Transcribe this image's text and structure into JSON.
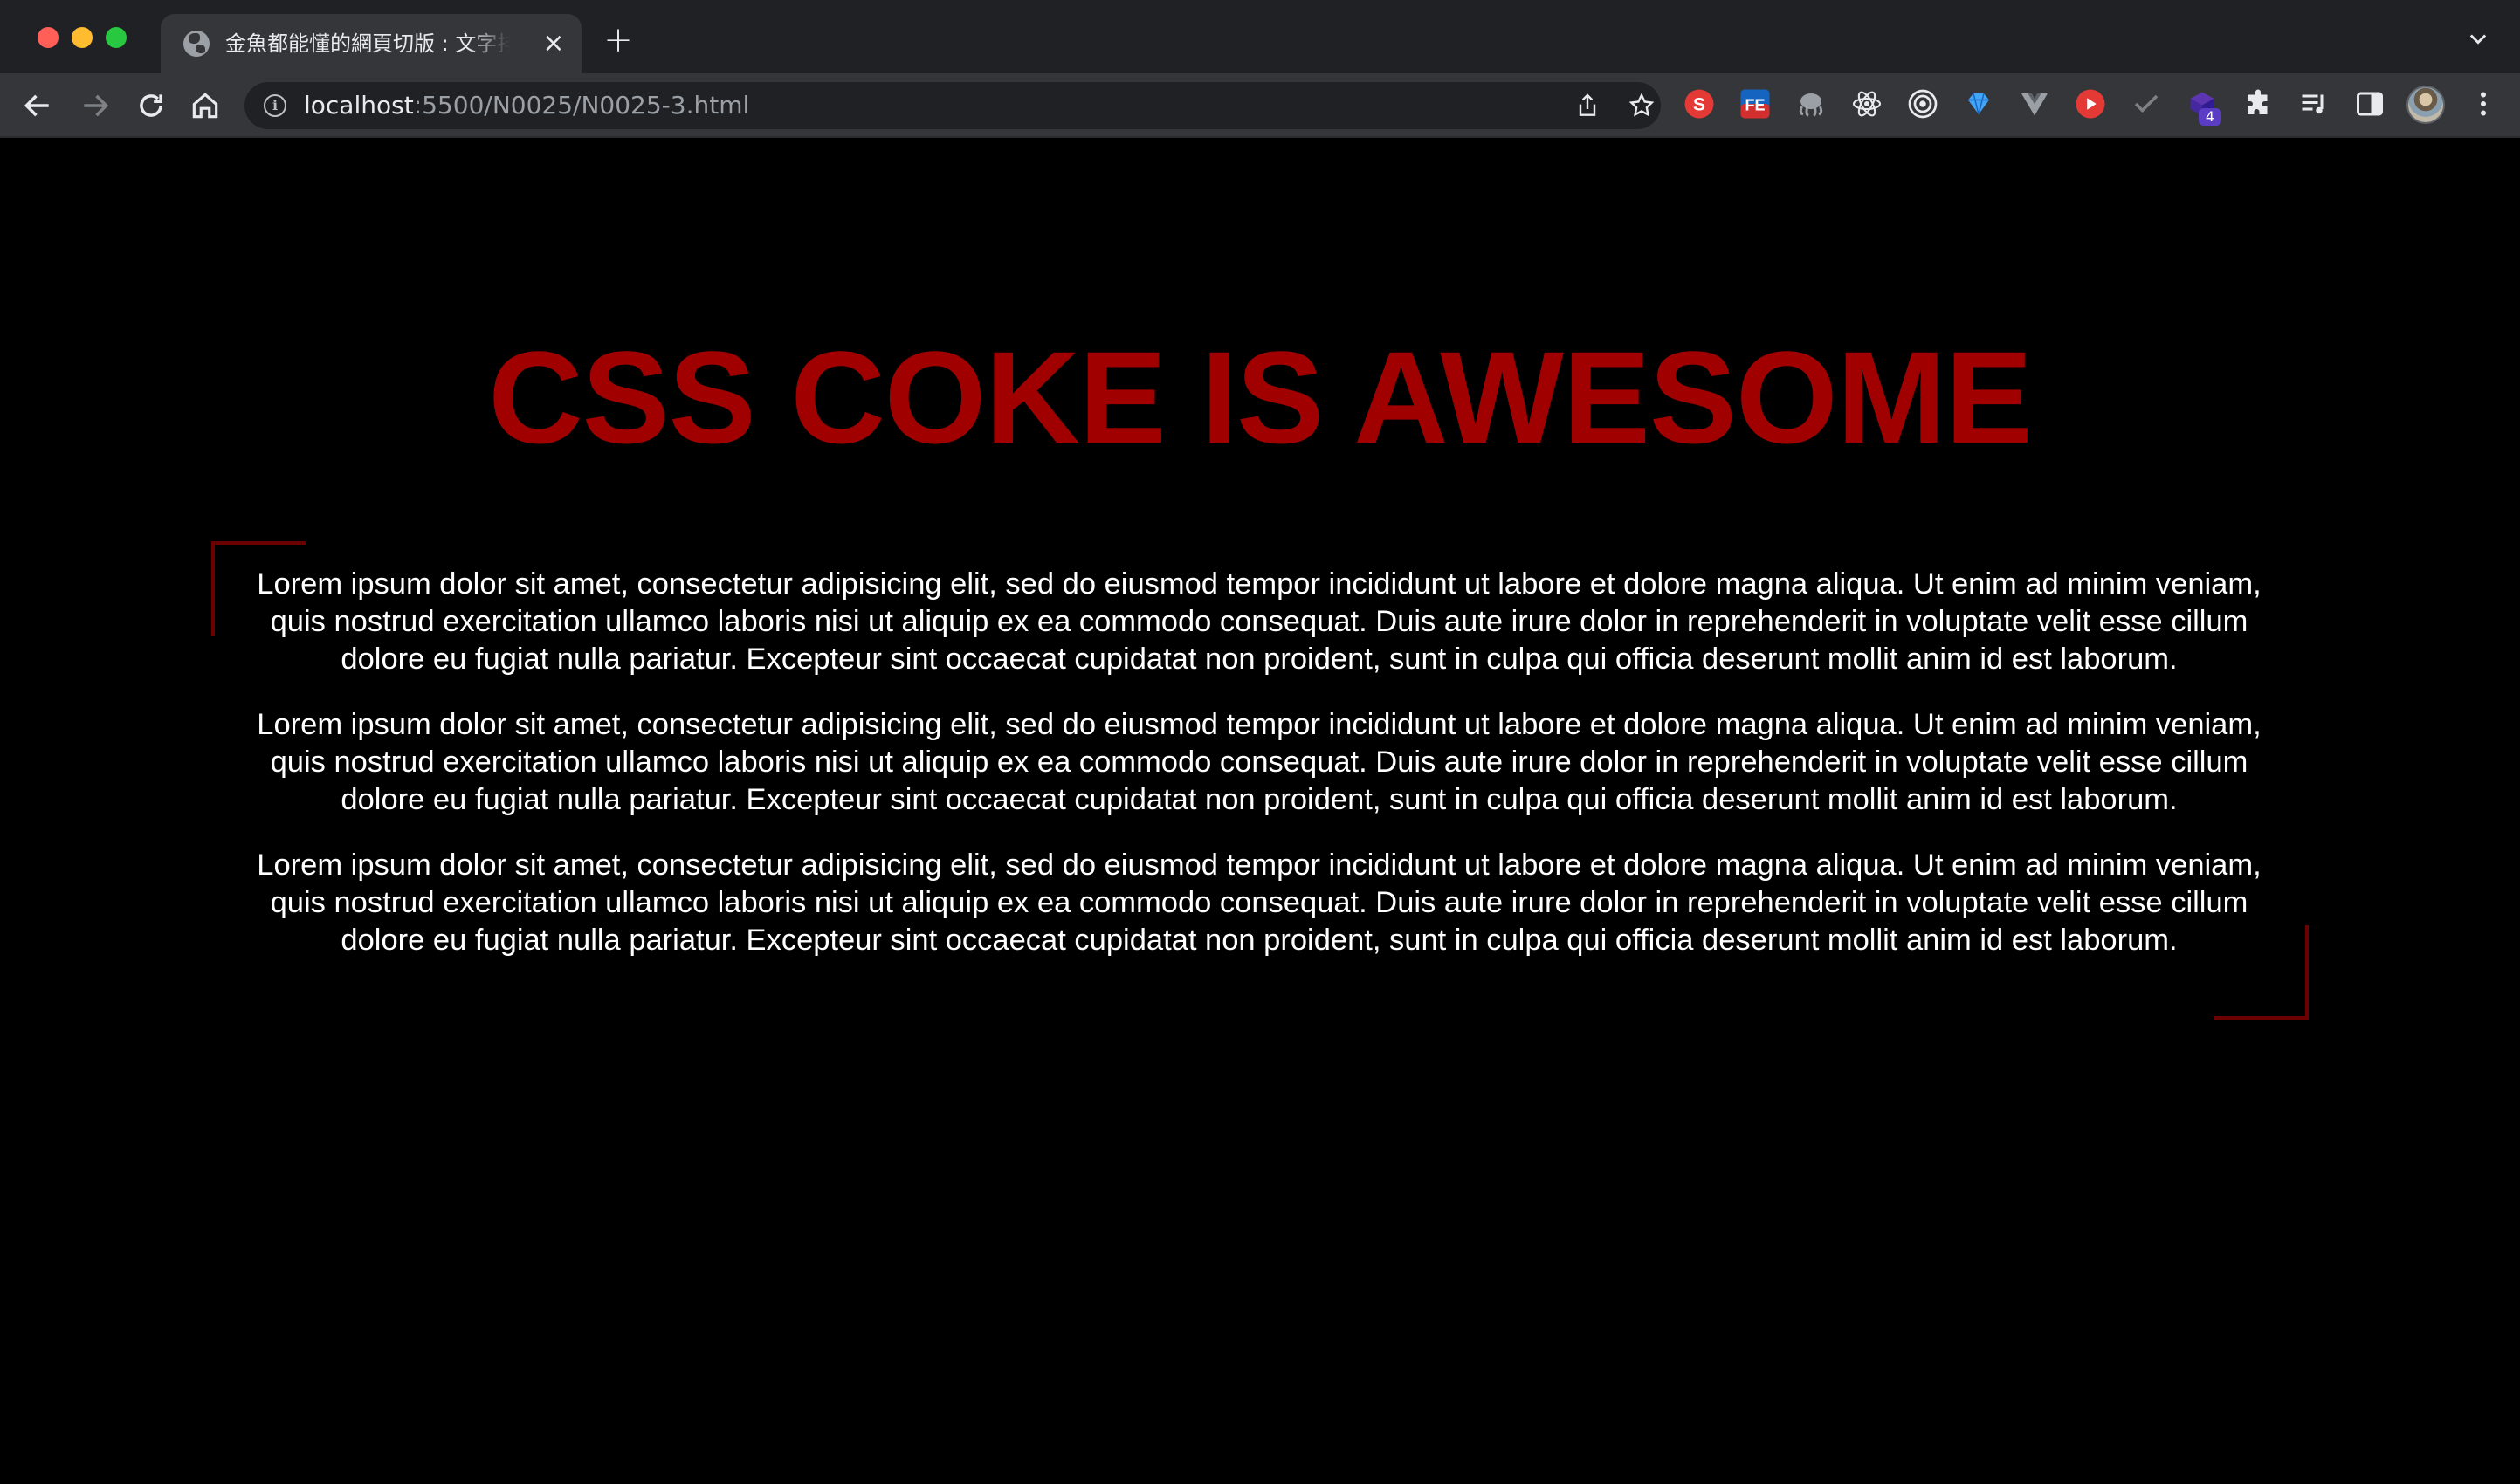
{
  "window": {
    "traffic_lights": [
      "close",
      "minimize",
      "zoom"
    ]
  },
  "tab": {
    "title": "金魚都能懂的網頁切版 : 文字排版",
    "favicon": "globe-icon"
  },
  "toolbar": {
    "url_host": "localhost",
    "url_path": ":5500/N0025/N0025-3.html"
  },
  "extensions": {
    "badge_count": "4",
    "icons": [
      "sumo-icon",
      "fe-icon",
      "octopus-icon",
      "react-devtools-icon",
      "target-icon",
      "gem-icon",
      "vue-devtools-icon",
      "youtube-icon",
      "check-icon",
      "extension-purple-icon",
      "puzzle-icon",
      "media-icon",
      "sidepanel-icon"
    ]
  },
  "content": {
    "headline": "CSS COKE IS AWESOME",
    "paragraphs": [
      "Lorem ipsum dolor sit amet, consectetur adipisicing elit, sed do eiusmod tempor incididunt ut labore et dolore magna aliqua. Ut enim ad minim veniam, quis nostrud exercitation ullamco laboris nisi ut aliquip ex ea commodo consequat. Duis aute irure dolor in reprehenderit in voluptate velit esse cillum dolore eu fugiat nulla pariatur. Excepteur sint occaecat cupidatat non proident, sunt in culpa qui officia deserunt mollit anim id est laborum.",
      "Lorem ipsum dolor sit amet, consectetur adipisicing elit, sed do eiusmod tempor incididunt ut labore et dolore magna aliqua. Ut enim ad minim veniam, quis nostrud exercitation ullamco laboris nisi ut aliquip ex ea commodo consequat. Duis aute irure dolor in reprehenderit in voluptate velit esse cillum dolore eu fugiat nulla pariatur. Excepteur sint occaecat cupidatat non proident, sunt in culpa qui officia deserunt mollit anim id est laborum.",
      "Lorem ipsum dolor sit amet, consectetur adipisicing elit, sed do eiusmod tempor incididunt ut labore et dolore magna aliqua. Ut enim ad minim veniam, quis nostrud exercitation ullamco laboris nisi ut aliquip ex ea commodo consequat. Duis aute irure dolor in reprehenderit in voluptate velit esse cillum dolore eu fugiat nulla pariatur. Excepteur sint occaecat cupidatat non proident, sunt in culpa qui officia deserunt mollit anim id est laborum."
    ]
  },
  "colors": {
    "page_bg": "#000000",
    "headline": "#a10000",
    "corner_frame": "#6a0000",
    "body_text": "#ffffff",
    "chrome_bg": "#202124",
    "toolbar_bg": "#35363a"
  }
}
